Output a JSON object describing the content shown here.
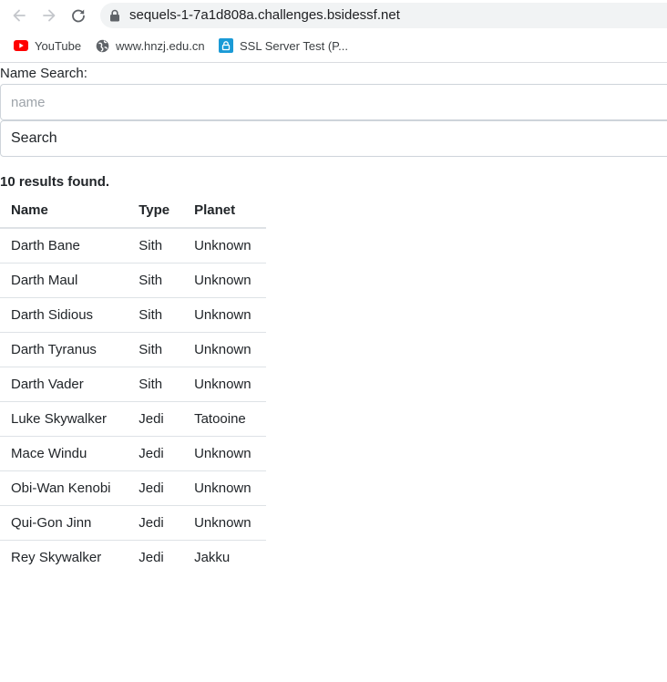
{
  "browser": {
    "url": "sequels-1-7a1d808a.challenges.bsidessf.net",
    "bookmarks": [
      {
        "label": "YouTube",
        "icon": "youtube-icon"
      },
      {
        "label": "www.hnzj.edu.cn",
        "icon": "globe-icon"
      },
      {
        "label": "SSL Server Test (P...",
        "icon": "lock-badge-icon"
      }
    ]
  },
  "search": {
    "label": "Name Search:",
    "placeholder": "name",
    "value": "",
    "button_label": "Search"
  },
  "results": {
    "summary": "10 results found.",
    "columns": [
      "Name",
      "Type",
      "Planet"
    ],
    "rows": [
      [
        "Darth Bane",
        "Sith",
        "Unknown"
      ],
      [
        "Darth Maul",
        "Sith",
        "Unknown"
      ],
      [
        "Darth Sidious",
        "Sith",
        "Unknown"
      ],
      [
        "Darth Tyranus",
        "Sith",
        "Unknown"
      ],
      [
        "Darth Vader",
        "Sith",
        "Unknown"
      ],
      [
        "Luke Skywalker",
        "Jedi",
        "Tatooine"
      ],
      [
        "Mace Windu",
        "Jedi",
        "Unknown"
      ],
      [
        "Obi-Wan Kenobi",
        "Jedi",
        "Unknown"
      ],
      [
        "Qui-Gon Jinn",
        "Jedi",
        "Unknown"
      ],
      [
        "Rey Skywalker",
        "Jedi",
        "Jakku"
      ]
    ]
  },
  "colors": {
    "youtube": "#ff0000",
    "ssl_badge": "#1a9ad6",
    "table_border": "#dee2e6"
  }
}
